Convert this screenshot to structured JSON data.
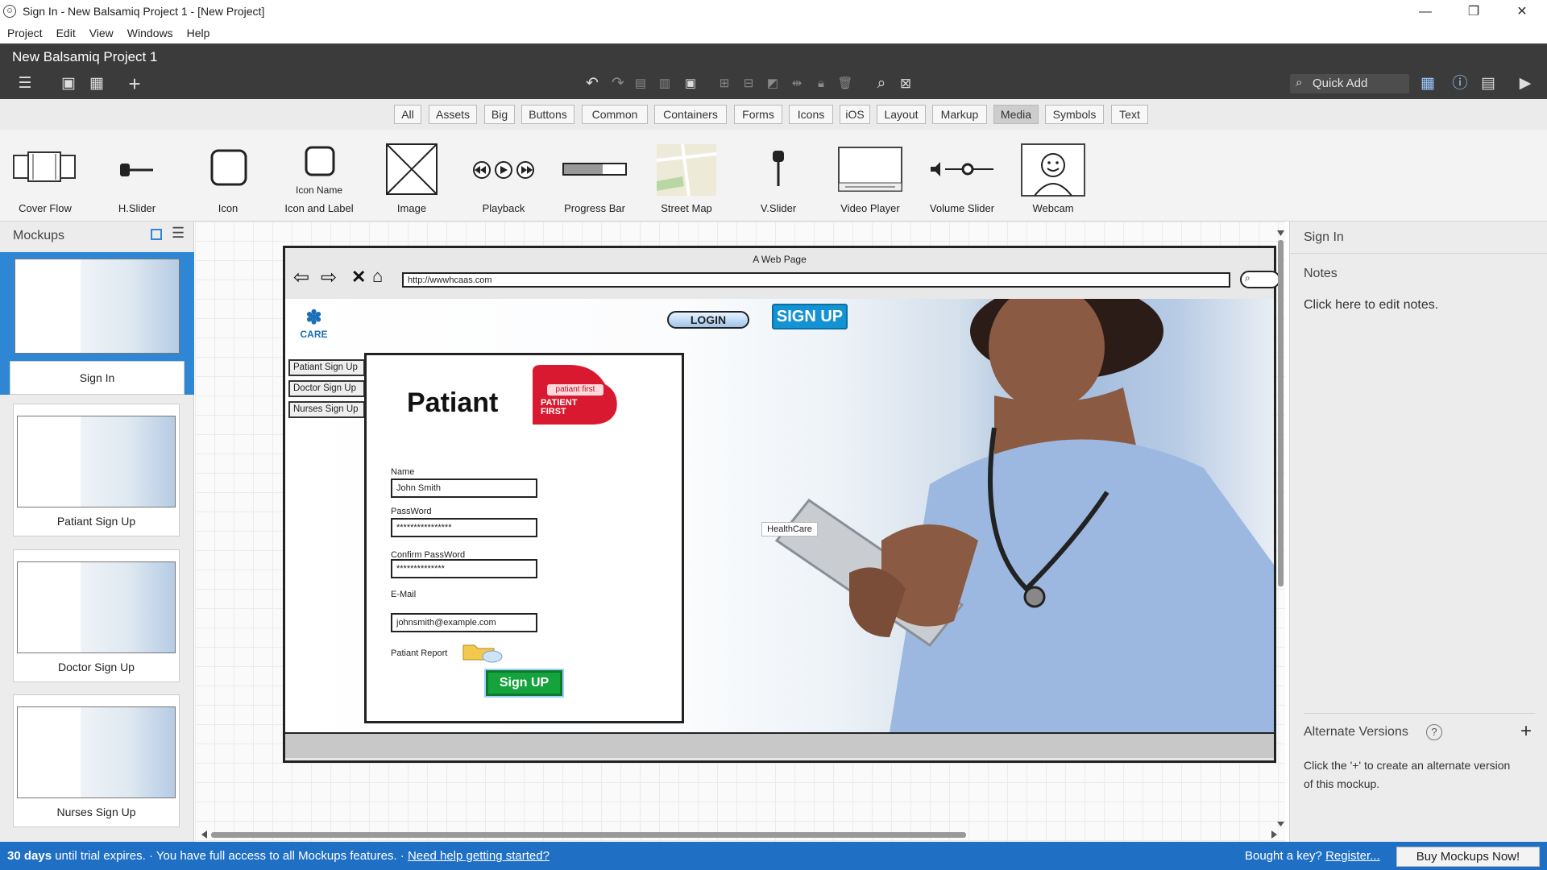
{
  "window": {
    "title": "Sign In - New Balsamiq Project 1 - [New Project]",
    "min": "—",
    "max": "❐",
    "close": "✕"
  },
  "menu": [
    "Project",
    "Edit",
    "View",
    "Windows",
    "Help"
  ],
  "app": {
    "project_title": "New Balsamiq Project 1",
    "quick_add_placeholder": "Quick Add"
  },
  "library_tabs": [
    "All",
    "Assets",
    "Big",
    "Buttons",
    "Common",
    "Containers",
    "Forms",
    "Icons",
    "iOS",
    "Layout",
    "Markup",
    "Media",
    "Symbols",
    "Text"
  ],
  "selected_library_tab": "Media",
  "components": [
    "Cover Flow",
    "H.Slider",
    "Icon",
    "Icon and Label",
    "Image",
    "Playback",
    "Progress Bar",
    "Street Map",
    "V.Slider",
    "Video Player",
    "Volume Slider",
    "Webcam"
  ],
  "icon_and_label_text": "Icon Name",
  "mockups_panel": {
    "title": "Mockups",
    "items": [
      "Sign In",
      "Patiant Sign Up",
      "Doctor Sign Up",
      "Nurses Sign Up"
    ],
    "selected": "Sign In"
  },
  "mockup": {
    "browser_title": "A Web Page",
    "url": "http://wwwhcaas.com",
    "logo_text": "CARE",
    "login_label": "LOGIN",
    "signup_label": "SIGN UP",
    "side_tabs": [
      "Patiant Sign Up",
      "Doctor Sign Up",
      "Nurses Sign Up"
    ],
    "form_heading": "Patiant",
    "badge_small": "patiant first",
    "badge_big": "PATIENT FIRST",
    "fields": [
      {
        "label": "Name",
        "value": "John Smith"
      },
      {
        "label": "PassWord",
        "value": "****************"
      },
      {
        "label": "Confirm PassWord",
        "value": "**************"
      },
      {
        "label": "E-Mail",
        "value": "johnsmith@example.com"
      }
    ],
    "report_label": "Patiant Report",
    "submit_label": "Sign UP",
    "healthcare_label": "HealthCare"
  },
  "properties": {
    "mockup_name": "Sign In",
    "notes_title": "Notes",
    "notes_hint": "Click here to edit notes.",
    "alt_title": "Alternate Versions",
    "alt_help": "?",
    "alt_hint": "Click the '+' to create an alternate version of this mockup."
  },
  "status": {
    "days": "30 days",
    "trial_text": "until trial expires.",
    "sep1": "·",
    "access_text": "You have full access to all Mockups features.",
    "sep2": "·",
    "help_link": "Need help getting started?",
    "bought": "Bought a key?",
    "register": "Register...",
    "buy": "Buy Mockups Now!"
  },
  "colors": {
    "header_bg": "#3b3b3b",
    "selection": "#2f86d4",
    "status_bar": "#1f6fc4",
    "signup_blue": "#1493d4",
    "submit_green": "#14a33c",
    "badge_red": "#d9192f"
  }
}
